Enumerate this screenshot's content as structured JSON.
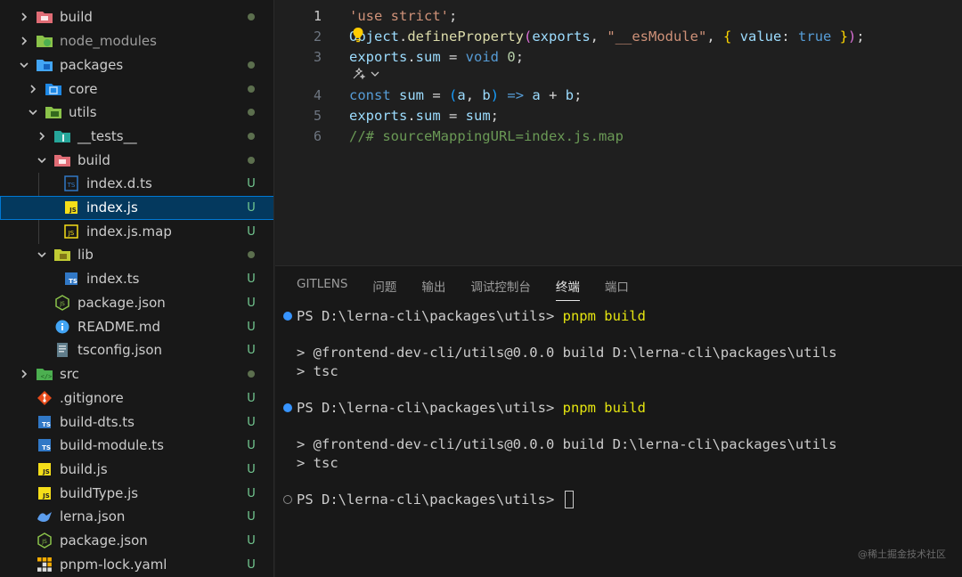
{
  "explorer": {
    "items": [
      {
        "label": "build",
        "status": "dot"
      },
      {
        "label": "node_modules",
        "status": ""
      },
      {
        "label": "packages",
        "status": "dot"
      },
      {
        "label": "core",
        "status": "dot"
      },
      {
        "label": "utils",
        "status": "dot"
      },
      {
        "label": "__tests__",
        "status": "dot"
      },
      {
        "label": "build",
        "status": "dot"
      },
      {
        "label": "index.d.ts",
        "status": "U"
      },
      {
        "label": "index.js",
        "status": "U"
      },
      {
        "label": "index.js.map",
        "status": "U"
      },
      {
        "label": "lib",
        "status": "dot"
      },
      {
        "label": "index.ts",
        "status": "U"
      },
      {
        "label": "package.json",
        "status": "U"
      },
      {
        "label": "README.md",
        "status": "U"
      },
      {
        "label": "tsconfig.json",
        "status": "U"
      },
      {
        "label": "src",
        "status": "dot"
      },
      {
        "label": ".gitignore",
        "status": "U"
      },
      {
        "label": "build-dts.ts",
        "status": "U"
      },
      {
        "label": "build-module.ts",
        "status": "U"
      },
      {
        "label": "build.js",
        "status": "U"
      },
      {
        "label": "buildType.js",
        "status": "U"
      },
      {
        "label": "lerna.json",
        "status": "U"
      },
      {
        "label": "package.json",
        "status": "U"
      },
      {
        "label": "pnpm-lock.yaml",
        "status": "U"
      }
    ]
  },
  "editor": {
    "line_numbers": [
      "1",
      "2",
      "3",
      "4",
      "5",
      "6"
    ],
    "lines": {
      "l1": [
        "'use strict'",
        ";"
      ],
      "l2": [
        "Object",
        ".",
        "defineProperty",
        "(",
        "exports",
        ", ",
        "\"__esModule\"",
        ", ",
        "{",
        " ",
        "value",
        ": ",
        "true",
        " ",
        "}",
        ")",
        ";"
      ],
      "l3": [
        "exports",
        ".",
        "sum",
        " = ",
        "void",
        " ",
        "0",
        ";"
      ],
      "l4": [
        "const",
        " ",
        "sum",
        " = ",
        "(",
        "a",
        ", ",
        "b",
        ")",
        " ",
        "=>",
        " ",
        "a",
        " + ",
        "b",
        ";"
      ],
      "l5": [
        "exports",
        ".",
        "sum",
        " = ",
        "sum",
        ";"
      ],
      "l6": [
        "//# sourceMappingURL=index.js.map"
      ]
    }
  },
  "panel": {
    "tabs": [
      "GITLENS",
      "问题",
      "输出",
      "调试控制台",
      "终端",
      "端口"
    ],
    "active_tab": "终端",
    "terminal": {
      "prompt1": "PS D:\\lerna-cli\\packages\\utils> ",
      "cmd1": "pnpm build",
      "out1a": "> @frontend-dev-cli/utils@0.0.0 build D:\\lerna-cli\\packages\\utils",
      "out1b": "> tsc",
      "prompt2": "PS D:\\lerna-cli\\packages\\utils> ",
      "cmd2": "pnpm build",
      "out2a": "> @frontend-dev-cli/utils@0.0.0 build D:\\lerna-cli\\packages\\utils",
      "out2b": "> tsc",
      "prompt3": "PS D:\\lerna-cli\\packages\\utils> "
    }
  },
  "watermark": "@稀土掘金技术社区",
  "colors": {
    "selection": "#04395e",
    "untracked": "#73c991",
    "terminal_command": "#e5e510"
  }
}
